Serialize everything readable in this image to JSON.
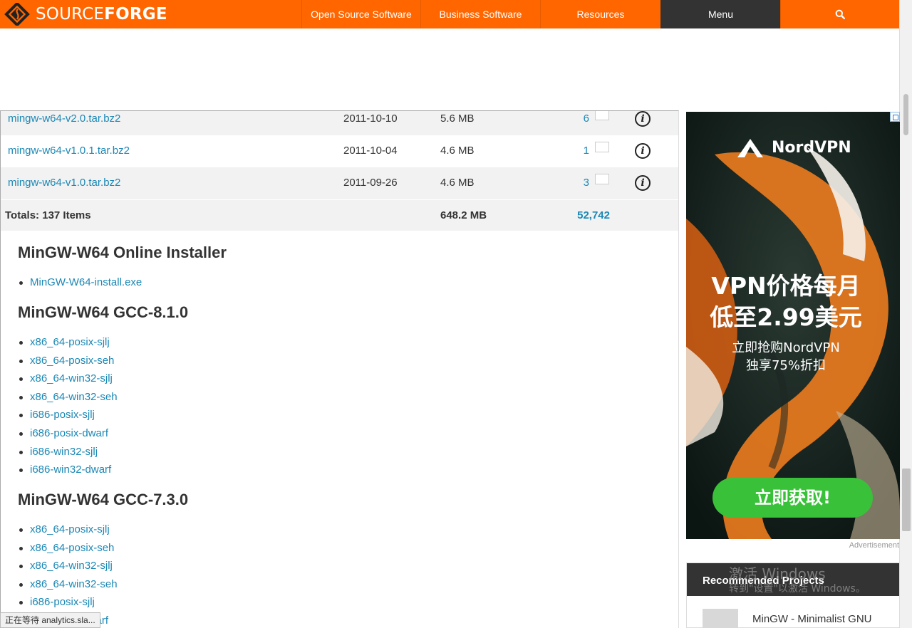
{
  "header": {
    "logo_light": "SOURCE",
    "logo_bold": "FORGE",
    "nav": [
      {
        "label": "Open Source Software"
      },
      {
        "label": "Business Software"
      },
      {
        "label": "Resources"
      },
      {
        "label": "Menu"
      }
    ],
    "search_icon": "search-icon"
  },
  "files": {
    "rows": [
      {
        "name": "mingw-w64-v2.0.tar.bz2",
        "date": "2011-10-10",
        "size": "5.6 MB",
        "downloads": "6"
      },
      {
        "name": "mingw-w64-v1.0.1.tar.bz2",
        "date": "2011-10-04",
        "size": "4.6 MB",
        "downloads": "1"
      },
      {
        "name": "mingw-w64-v1.0.tar.bz2",
        "date": "2011-09-26",
        "size": "4.6 MB",
        "downloads": "3"
      }
    ],
    "info_glyph": "i",
    "totals": {
      "label": "Totals: 137 Items",
      "size": "648.2 MB",
      "downloads": "52,742"
    }
  },
  "sections": [
    {
      "title": "MinGW-W64 Online Installer",
      "links": [
        "MinGW-W64-install.exe"
      ]
    },
    {
      "title": "MinGW-W64 GCC-8.1.0",
      "links": [
        "x86_64-posix-sjlj",
        "x86_64-posix-seh",
        "x86_64-win32-sjlj",
        "x86_64-win32-seh",
        "i686-posix-sjlj",
        "i686-posix-dwarf",
        "i686-win32-sjlj",
        "i686-win32-dwarf"
      ]
    },
    {
      "title": "MinGW-W64 GCC-7.3.0",
      "links": [
        "x86_64-posix-sjlj",
        "x86_64-posix-seh",
        "x86_64-win32-sjlj",
        "x86_64-win32-seh",
        "i686-posix-sjlj",
        "i686-posix-dwarf"
      ]
    }
  ],
  "ad": {
    "brand": "NordVPN",
    "headline_1": "VPN价格每月",
    "headline_2": "低至2.99美元",
    "sub_1": "立即抢购NordVPN",
    "sub_2": "独享75%折扣",
    "cta": "立即获取!",
    "label": "Advertisement"
  },
  "recommended": {
    "title": "Recommended Projects",
    "item": "MinGW - Minimalist GNU"
  },
  "watermark": {
    "line1": "激活 Windows",
    "line2": "转到\"设置\"以激活 Windows。"
  },
  "status_bar": "正在等待 analytics.sla..."
}
